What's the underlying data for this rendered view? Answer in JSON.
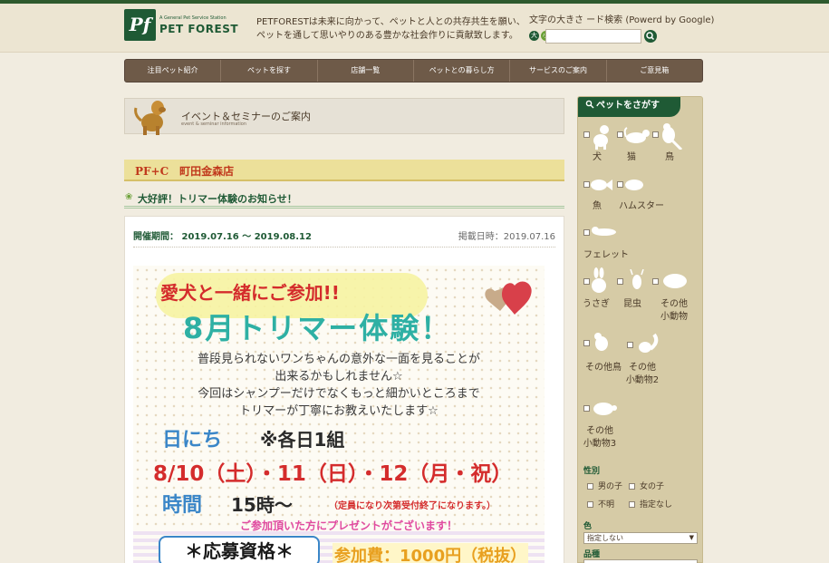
{
  "header": {
    "logo_mark": "Pf",
    "logo_tagline": "A General Pet Service Station",
    "logo_name": "PET FOREST",
    "tagline_line1": "PETFORESTは未来に向かって、ペットと人との共存共生を願い、",
    "tagline_line2": "ペットを通して思いやりのある豊かな社会作りに貢献致します。",
    "search_label": "文字の大きさ ード検索 (Powerd by Google)",
    "size_large": "大",
    "size_small": "小",
    "search_value": "",
    "search_icon": "magnifier-icon"
  },
  "nav": {
    "items": [
      "注目ペット紹介",
      "ペットを探す",
      "店舗一覧",
      "ペットとの暮らし方",
      "サービスのご案内",
      "ご意見箱"
    ]
  },
  "banner": {
    "title": "イベント＆セミナーのご案内",
    "subtitle": "event & seminar information"
  },
  "shop": {
    "name": "PF+C　町田金森店"
  },
  "event": {
    "title": "大好評！トリマー体験のお知らせ！",
    "period": "開催期間： 2019.07.16 ～ 2019.08.12",
    "posted": "掲載日時：2019.07.16"
  },
  "flyer": {
    "line1": "愛犬と一緒にご参加!!",
    "title": "8月トリマー体験！",
    "body": "普段見られないワンちゃんの意外な一面を見ることが\n出来るかもしれません☆\n今回はシャンプーだけでなくもっと細かいところまで\nトリマーが丁寧にお教えいたします☆",
    "date_label": "日にち",
    "per_group": "※各日1組",
    "dates": "8/10（土）・11（日）・12（月・祝）",
    "time_label": "時間",
    "time": "15時～",
    "time_note": "（定員になり次第受付終了になります。）",
    "present": "ご参加頂いた方にプレゼントがございます！",
    "qualification": "＊応募資格＊",
    "fee": "参加費：1000円（税抜）"
  },
  "sidebar": {
    "title": "ペットをさがす",
    "animals": [
      {
        "label": "犬"
      },
      {
        "label": "猫"
      },
      {
        "label": "鳥"
      },
      {
        "label": "魚"
      },
      {
        "label": "ハムスター"
      },
      {
        "label": "フェレット"
      },
      {
        "label": "うさぎ"
      },
      {
        "label": "昆虫"
      },
      {
        "label": "その他\n小動物"
      },
      {
        "label": "その他鳥"
      },
      {
        "label": "その他\n小動物2"
      },
      {
        "label": "その他\n小動物3"
      }
    ],
    "gender_label": "性別",
    "gender_options": [
      "男の子",
      "女の子",
      "不明",
      "指定なし"
    ],
    "color_label": "色",
    "color_value": "指定しない",
    "breed_label": "品種"
  }
}
